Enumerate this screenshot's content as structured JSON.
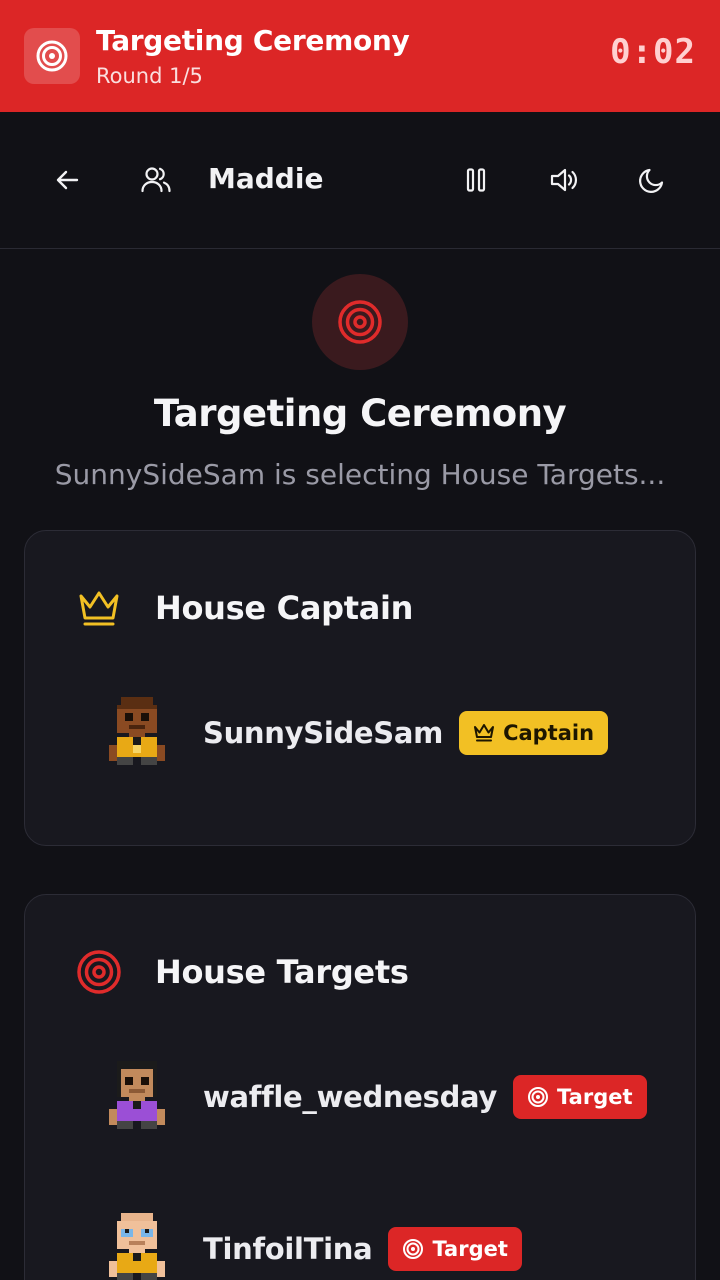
{
  "banner": {
    "title": "Targeting Ceremony",
    "subtitle": "Round 1/5",
    "timer": "0:02",
    "icon": "target-icon",
    "color": "#dc2626"
  },
  "nav": {
    "player_name": "Maddie",
    "icons": [
      "arrow-left-icon",
      "users-icon",
      "pause-icon",
      "volume-icon",
      "moon-icon"
    ]
  },
  "heading": {
    "title": "Targeting Ceremony",
    "subtitle": "SunnySideSam is selecting House Targets..."
  },
  "captain_section": {
    "title": "House Captain",
    "icon": "crown-icon",
    "player": {
      "name": "SunnySideSam",
      "badge": "Captain"
    }
  },
  "targets_section": {
    "title": "House Targets",
    "icon": "target-icon",
    "players": [
      {
        "name": "waffle_wednesday",
        "badge": "Target"
      },
      {
        "name": "TinfoilTina",
        "badge": "Target"
      }
    ]
  },
  "colors": {
    "accent_red": "#dc2626",
    "captain_gold": "#f2c024",
    "background": "#111116",
    "card": "#18181f"
  }
}
